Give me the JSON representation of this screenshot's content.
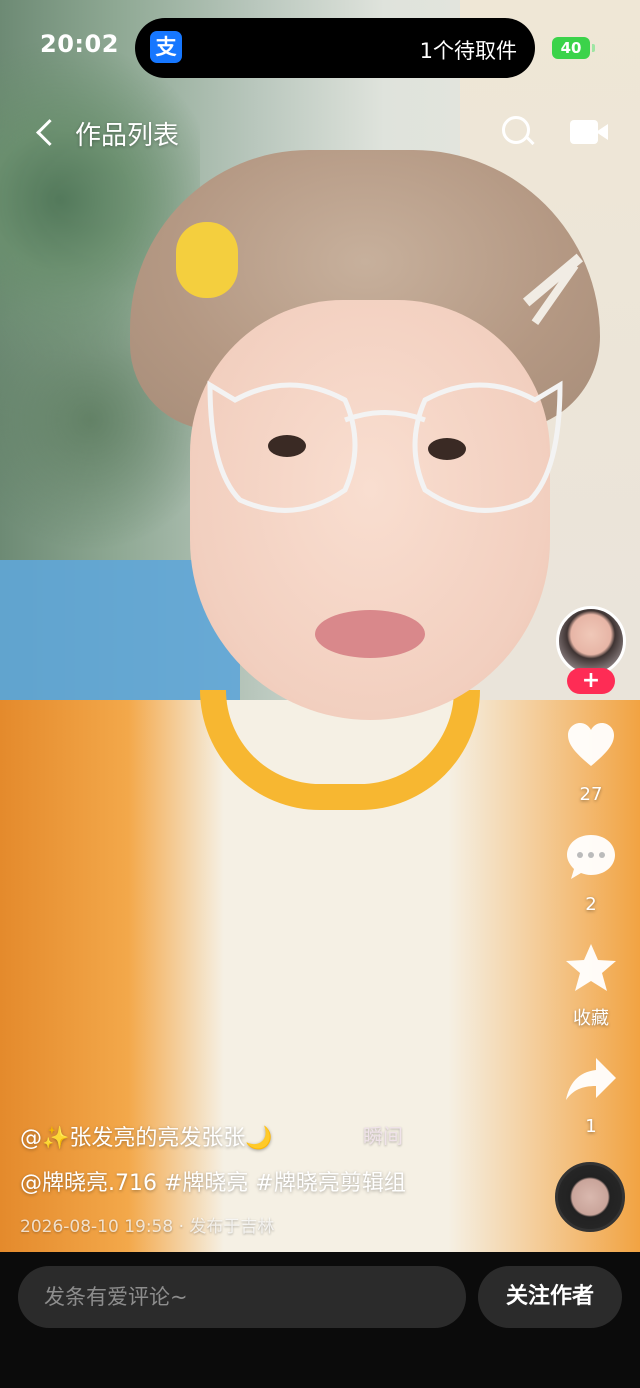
{
  "status_bar": {
    "time": "20:02",
    "island_app": "支",
    "island_text": "1个待取件",
    "battery": "40"
  },
  "header": {
    "title": "作品列表"
  },
  "rail": {
    "like_count": "27",
    "comment_count": "2",
    "favorite_label": "收藏",
    "share_count": "1",
    "follow_plus": "+"
  },
  "caption": {
    "line1": "@✨张发亮的亮发张张🌙",
    "moment_tag": "瞬间",
    "line2": "@牌晓亮.716 #牌晓亮 #牌晓亮剪辑组",
    "meta": "2026-08-10 19:58 · 发布于吉林"
  },
  "bottom_bar": {
    "comment_placeholder": "发条有爱评论~",
    "follow_label": "关注作者"
  },
  "colors": {
    "accent_red": "#fe2c55",
    "alipay_blue": "#1677ff",
    "battery_green": "#3bd34a"
  },
  "icons": [
    "back-icon",
    "search-icon",
    "camera-icon",
    "heart-icon",
    "comment-icon",
    "star-icon",
    "share-icon",
    "music-disc-icon"
  ]
}
